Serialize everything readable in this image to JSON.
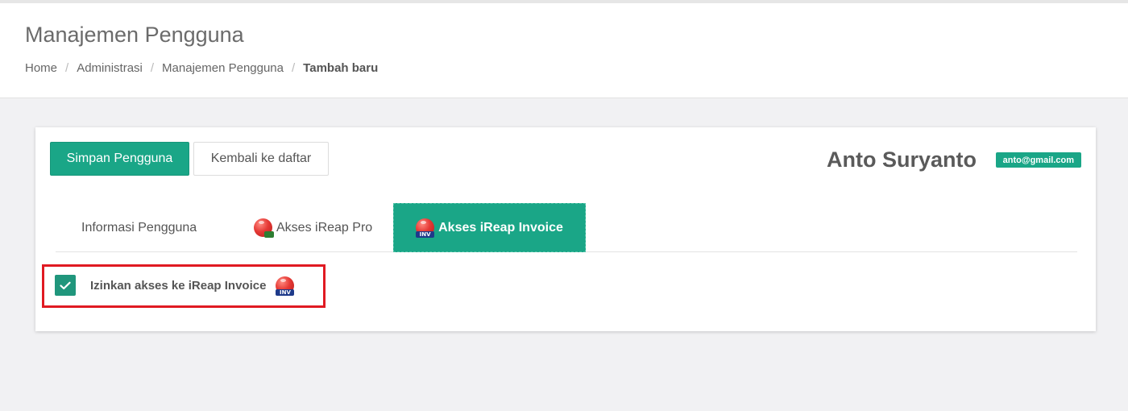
{
  "header": {
    "title": "Manajemen Pengguna",
    "breadcrumb": [
      "Home",
      "Administrasi",
      "Manajemen Pengguna",
      "Tambah baru"
    ]
  },
  "toolbar": {
    "save_label": "Simpan Pengguna",
    "back_label": "Kembali ke daftar"
  },
  "user": {
    "name": "Anto Suryanto",
    "email": "anto@gmail.com"
  },
  "tabs": [
    {
      "label": "Informasi Pengguna",
      "icon": "none",
      "active": false
    },
    {
      "label": "Akses iReap Pro",
      "icon": "ireap-pro-icon",
      "active": false
    },
    {
      "label": "Akses iReap Invoice",
      "icon": "ireap-invoice-icon",
      "active": true
    }
  ],
  "permission": {
    "label": "Izinkan akses ke iReap Invoice",
    "checked": true,
    "icon": "ireap-invoice-icon"
  },
  "icon_text": {
    "inv": "INV"
  },
  "colors": {
    "accent": "#1aa687",
    "checkbox": "#20967c",
    "highlight": "#e01a22"
  }
}
